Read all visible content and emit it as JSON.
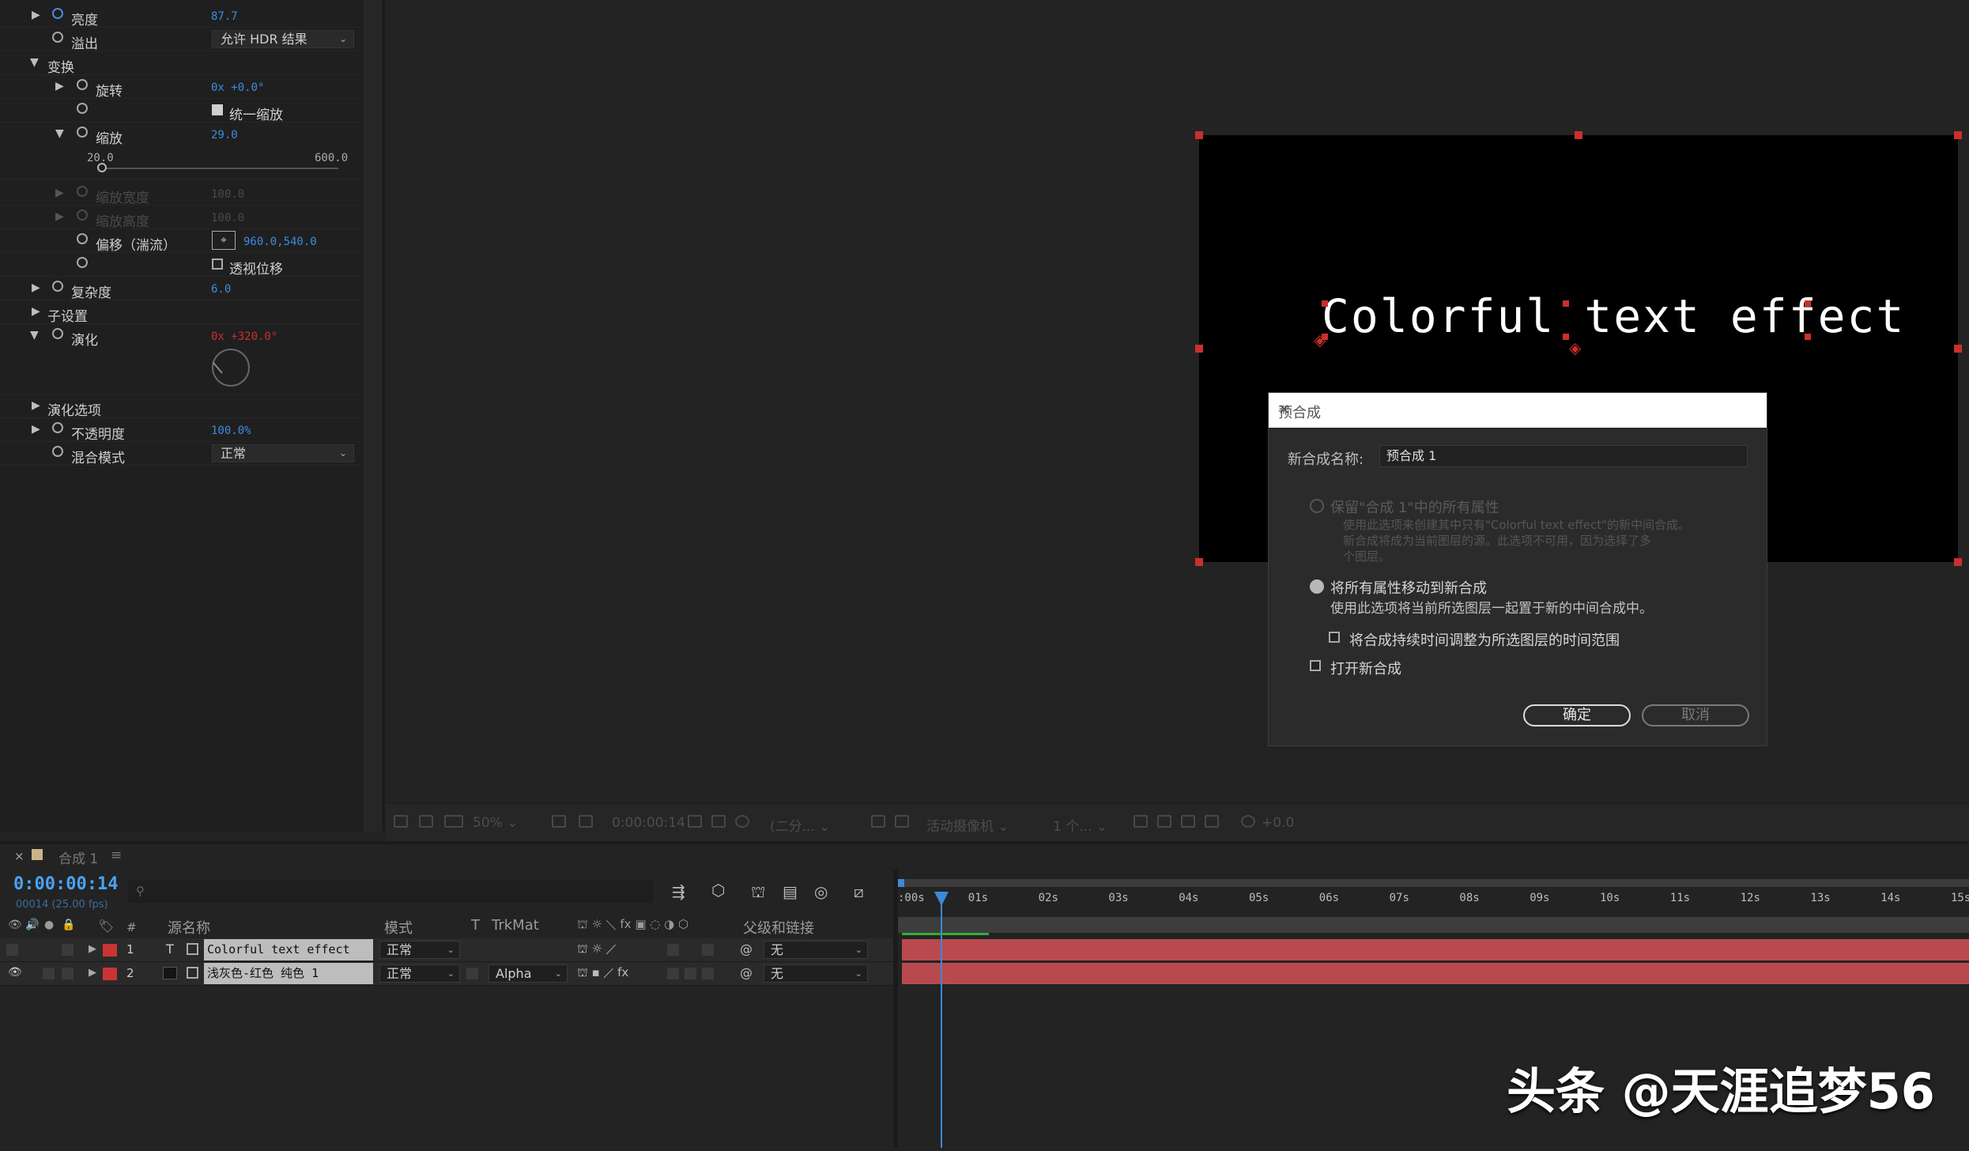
{
  "effect_controls": {
    "brightness": {
      "label": "亮度",
      "value": "87.7"
    },
    "overflow": {
      "label": "溢出",
      "value": "允许 HDR 结果"
    },
    "transform": {
      "label": "变换"
    },
    "rotation": {
      "label": "旋转",
      "value": "0x +0.0°"
    },
    "uniform_scale": {
      "label": "统一缩放",
      "checked": true
    },
    "scale": {
      "label": "缩放",
      "value": "29.0",
      "slider_min": "20.0",
      "slider_max": "600.0",
      "slider_fraction": 0.016
    },
    "scale_width": {
      "label": "缩放宽度",
      "value": "100.0"
    },
    "scale_height": {
      "label": "缩放高度",
      "value": "100.0"
    },
    "offset": {
      "label": "偏移（湍流）",
      "value": "960.0,540.0"
    },
    "perspective_offset": {
      "label": "透视位移",
      "checked": false
    },
    "complexity": {
      "label": "复杂度",
      "value": "6.0"
    },
    "sub_settings": {
      "label": "子设置"
    },
    "evolution": {
      "label": "演化",
      "value": "0x +320.0°"
    },
    "evolution_options": {
      "label": "演化选项"
    },
    "opacity": {
      "label": "不透明度",
      "value": "100.0%"
    },
    "blend_mode": {
      "label": "混合模式",
      "value": "正常"
    }
  },
  "viewer": {
    "sample_text": "Colorful text effect",
    "toolbar": {
      "zoom": "50%",
      "timecode": "0:00:00:14",
      "resolution": "(二分...",
      "camera": "活动摄像机",
      "views": "1 个...",
      "exposure": "+0.0"
    }
  },
  "dialog": {
    "title": "预合成",
    "name_label": "新合成名称:",
    "name_value": "预合成 1",
    "option1_label": "保留\"合成 1\"中的所有属性",
    "option1_desc": [
      "使用此选项来创建其中只有\"Colorful text effect\"的新中间合成。",
      "新合成将成为当前图层的源。此选项不可用，因为选择了多",
      "个图层。"
    ],
    "option2_label": "将所有属性移动到新合成",
    "option2_desc": "使用此选项将当前所选图层一起置于新的中间合成中。",
    "adjust_duration_label": "将合成持续时间调整为所选图层的时间范围",
    "open_new_label": "打开新合成",
    "ok": "确定",
    "cancel": "取消"
  },
  "timeline": {
    "comp_tab": "合成 1",
    "timecode": "0:00:00:14",
    "fps": "00014 (25.00 fps)",
    "columns": {
      "num": "#",
      "source_name": "源名称",
      "mode": "模式",
      "t": "T",
      "trkmat": "TrkMat",
      "parent": "父级和链接"
    },
    "layers": [
      {
        "num": "1",
        "type": "T",
        "name": "Colorful text effect",
        "mode": "正常",
        "trkmat": "",
        "parent": "无"
      },
      {
        "num": "2",
        "type": "",
        "name": "浅灰色-红色 纯色 1",
        "mode": "正常",
        "trkmat": "Alpha",
        "parent": "无"
      }
    ],
    "ruler": [
      ":00s",
      "01s",
      "02s",
      "03s",
      "04s",
      "05s",
      "06s",
      "07s",
      "08s",
      "09s",
      "10s",
      "11s",
      "12s",
      "13s",
      "14s",
      "15s"
    ]
  },
  "watermark": "头条 @天涯追梦56",
  "colors": {
    "accent_blue": "#4aa3f5",
    "layer_red": "#cb3434",
    "bar_red": "#b84a4f",
    "handle_red": "#c9302c"
  }
}
